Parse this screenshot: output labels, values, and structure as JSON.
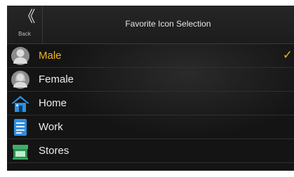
{
  "header": {
    "back_icon": "back-chevron-icon",
    "back_glyph": "《",
    "back_label": "Back",
    "title": "Favorite Icon Selection"
  },
  "items": [
    {
      "label": "Male",
      "icon": "male-person-icon",
      "selected": true,
      "check_glyph": "✓"
    },
    {
      "label": "Female",
      "icon": "female-person-icon",
      "selected": false
    },
    {
      "label": "Home",
      "icon": "home-icon",
      "selected": false
    },
    {
      "label": "Work",
      "icon": "work-icon",
      "selected": false
    },
    {
      "label": "Stores",
      "icon": "store-icon",
      "selected": false
    }
  ],
  "colors": {
    "accent": "#f0b51e",
    "background": "#141414",
    "text": "#ececec"
  }
}
